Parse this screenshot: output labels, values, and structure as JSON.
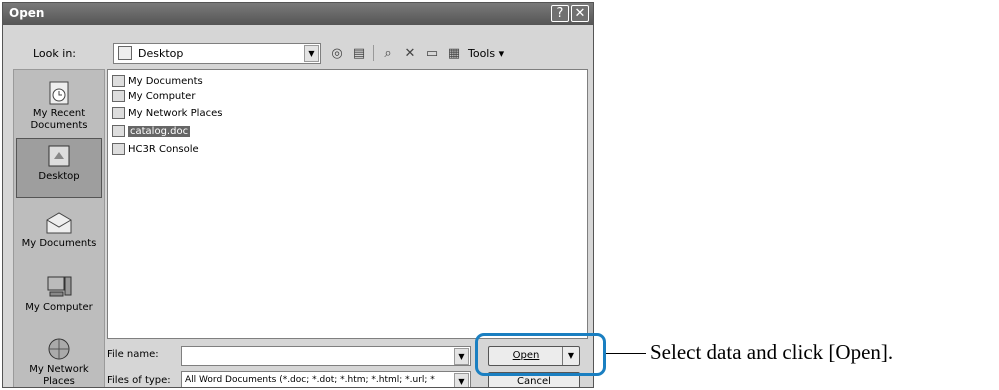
{
  "dialog": {
    "title": "Open",
    "help_glyph": "?",
    "close_glyph": "✕"
  },
  "look_in": {
    "label": "Look in:",
    "value": "Desktop",
    "icon": "desktop-icon"
  },
  "toolbar": {
    "tools_label": "Tools",
    "icons": [
      "back-icon",
      "up-folder-icon",
      "search-web-icon",
      "delete-icon",
      "new-folder-icon",
      "views-icon"
    ]
  },
  "places": [
    {
      "label": "My Recent Documents",
      "icon": "recent-documents-icon"
    },
    {
      "label": "Desktop",
      "icon": "desktop-icon",
      "selected": true
    },
    {
      "label": "My Documents",
      "icon": "my-documents-icon"
    },
    {
      "label": "My Computer",
      "icon": "my-computer-icon"
    },
    {
      "label": "My Network Places",
      "icon": "network-places-icon"
    }
  ],
  "files": [
    {
      "name": "My Documents",
      "icon": "folder-icon"
    },
    {
      "name": "My Computer",
      "icon": "computer-icon"
    },
    {
      "name": "My Network Places",
      "icon": "network-icon"
    },
    {
      "name": "catalog.doc",
      "icon": "word-document-icon",
      "selected": true
    },
    {
      "name": "HC3R Console",
      "icon": "shortcut-icon"
    }
  ],
  "file_name": {
    "label": "File name:",
    "value": ""
  },
  "file_type": {
    "label": "Files of type:",
    "value": "All Word Documents (*.doc; *.dot; *.htm; *.html; *.url; *"
  },
  "buttons": {
    "open": "Open",
    "cancel": "Cancel"
  },
  "annotation": {
    "text": "Select data and click [Open].",
    "highlight_color": "#1a7fc1"
  }
}
